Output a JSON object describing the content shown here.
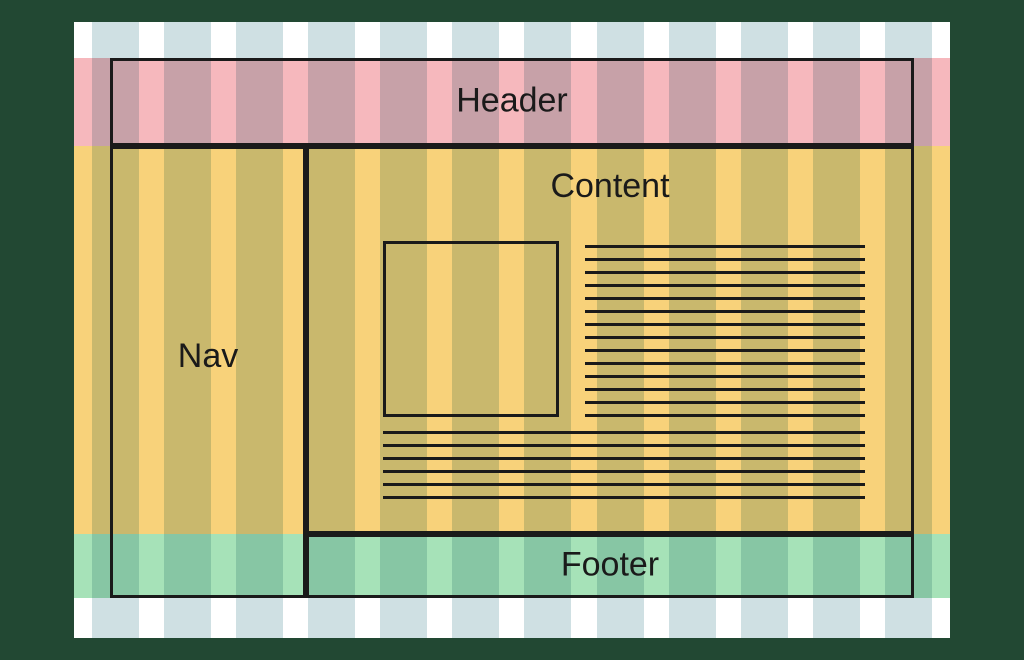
{
  "layout": {
    "header": {
      "label": "Header"
    },
    "nav": {
      "label": "Nav"
    },
    "content": {
      "label": "Content"
    },
    "footer": {
      "label": "Footer"
    }
  },
  "diagram": {
    "columns": 12,
    "bands": [
      "header",
      "middle",
      "footer"
    ],
    "content_placeholder": {
      "image_box": true,
      "upper_text_lines": 14,
      "lower_text_lines": 6
    }
  }
}
